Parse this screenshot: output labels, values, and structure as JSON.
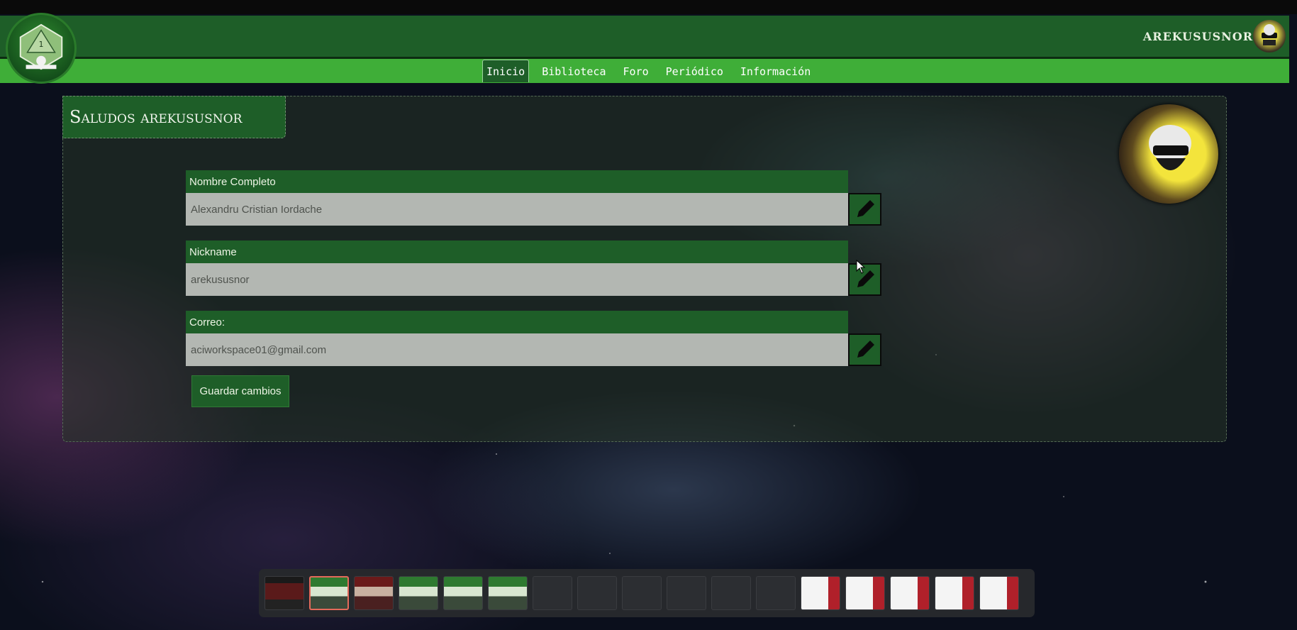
{
  "header": {
    "logo_number": "1",
    "username": "AREKUSUSNOR"
  },
  "nav": {
    "items": [
      "Inicio",
      "Biblioteca",
      "Foro",
      "Periódico",
      "Información"
    ],
    "active": "Inicio"
  },
  "panel": {
    "title": "Saludos arekususnor"
  },
  "form": {
    "full_name_label": "Nombre Completo",
    "full_name_value": "Alexandru Cristian Iordache",
    "nickname_label": "Nickname",
    "nickname_value": "arekususnor",
    "email_label": "Correo:",
    "email_value": "aciworkspace01@gmail.com",
    "save_label": "Guardar cambios"
  },
  "thumbnails": [
    {
      "style": "dark-red"
    },
    {
      "style": "green",
      "selected": true
    },
    {
      "style": "red"
    },
    {
      "style": "green"
    },
    {
      "style": "green"
    },
    {
      "style": "green"
    },
    {
      "style": "dark"
    },
    {
      "style": "dark"
    },
    {
      "style": "dark"
    },
    {
      "style": "dark"
    },
    {
      "style": "dark"
    },
    {
      "style": "dark"
    },
    {
      "style": "white"
    },
    {
      "style": "white"
    },
    {
      "style": "white"
    },
    {
      "style": "white"
    },
    {
      "style": "white"
    }
  ],
  "colors": {
    "header_green": "#1e5e28",
    "nav_green": "#3fae38",
    "input_gray": "#b3b7b2",
    "selected_thumb": "#e46a5b"
  }
}
